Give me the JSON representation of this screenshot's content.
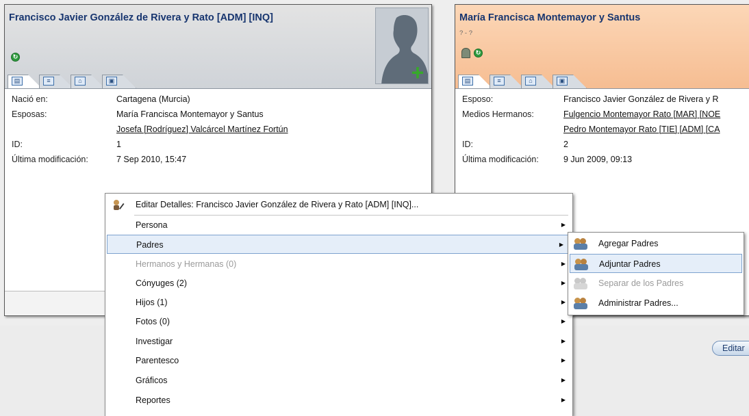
{
  "left_card": {
    "name": "Francisco Javier González de Rivera y Rato [ADM] [INQ]",
    "rows": [
      {
        "label": "Nació en:",
        "value": "Cartagena (Murcia)"
      },
      {
        "label": "Esposas:",
        "value": "María Francisca Montemayor y Santus"
      },
      {
        "label": "",
        "value": "Josefa [Rodríguez] Valcárcel Martínez Fortún"
      },
      {
        "label": "ID:",
        "value": "1"
      },
      {
        "label": "Última modificación:",
        "value": "7 Sep 2010, 15:47"
      }
    ]
  },
  "right_card": {
    "name": "María Francisca Montemayor y Santus",
    "dates": "? - ?",
    "rows": [
      {
        "label": "Esposo:",
        "value": "Francisco Javier González de Rivera y R"
      },
      {
        "label": "Medios Hermanos:",
        "value": "Fulgencio Montemayor Rato [MAR] [NOE"
      },
      {
        "label": "",
        "value": "Pedro Montemayor Rato [TIE] [ADM] [CA"
      },
      {
        "label": "ID:",
        "value": "2"
      },
      {
        "label": "Última modificación:",
        "value": "9 Jun 2009, 09:13"
      }
    ],
    "edit_button": "Editar"
  },
  "main_menu": {
    "items": [
      {
        "label": "Editar Detalles: Francisco Javier González de Rivera y Rato [ADM] [INQ]..."
      },
      {
        "label": "Persona"
      },
      {
        "label": "Padres"
      },
      {
        "label": "Hermanos y Hermanas (0)"
      },
      {
        "label": "Cónyuges (2)"
      },
      {
        "label": "Hijos (1)"
      },
      {
        "label": "Fotos (0)"
      },
      {
        "label": "Investigar"
      },
      {
        "label": "Parentesco"
      },
      {
        "label": "Gráficos"
      },
      {
        "label": "Reportes"
      }
    ]
  },
  "sub_menu": {
    "items": [
      {
        "label": "Agregar Padres"
      },
      {
        "label": "Adjuntar Padres"
      },
      {
        "label": "Separar de los Padres"
      },
      {
        "label": "Administrar Padres..."
      }
    ]
  },
  "colors": {
    "name_text": "#17356f",
    "right_header": "#f6bd92",
    "status_green": "#2e9b3e",
    "menu_highlight": "#e5eef9"
  }
}
